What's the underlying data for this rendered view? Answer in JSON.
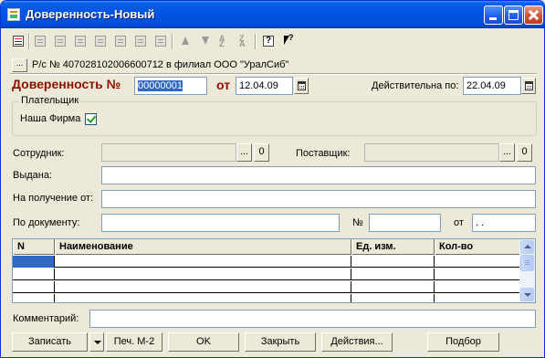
{
  "window": {
    "title": "Доверенность-Новый"
  },
  "toolbar": {
    "items": [
      {
        "name": "new-row-icon",
        "enabled": true
      },
      {
        "name": "copy-row-icon",
        "enabled": false
      },
      {
        "name": "edit-row-icon",
        "enabled": false
      },
      {
        "name": "delete-row-icon",
        "enabled": false
      },
      {
        "name": "mark-delete-icon",
        "enabled": false
      },
      {
        "name": "cut-icon",
        "enabled": false
      },
      {
        "name": "edit-cell-icon",
        "enabled": false
      },
      {
        "name": "end-edit-icon",
        "enabled": false
      },
      {
        "name": "move-up-icon",
        "enabled": false
      },
      {
        "name": "move-down-icon",
        "enabled": false
      },
      {
        "name": "sort-asc-icon",
        "enabled": false
      },
      {
        "name": "sort-desc-icon",
        "enabled": false
      },
      {
        "name": "help-icon",
        "enabled": true
      },
      {
        "name": "whats-this-icon",
        "enabled": true
      }
    ]
  },
  "account": {
    "button_label": "...",
    "text": "Р/с № 407028102006600712 в филиал ООО \"УралСиб\""
  },
  "header": {
    "doc_title": "Доверенность №",
    "number": "00000001",
    "from_label": "от",
    "date": "12.04.09",
    "valid_label": "Действительна по:",
    "valid_date": "22.04.09"
  },
  "payer": {
    "group_title": "Плательщик",
    "our_firm_label": "Наша Фирма",
    "our_firm_checked": true
  },
  "fields": {
    "employee_label": "Сотрудник:",
    "employee_value": "",
    "supplier_label": "Поставщик:",
    "supplier_value": "",
    "issued_label": "Выдана:",
    "issued_value": "",
    "receive_from_label": "На получение от:",
    "receive_from_value": "",
    "by_document_label": "По документу:",
    "by_document_value": "",
    "doc_number_label": "№",
    "doc_number_value": "",
    "doc_date_label": "от",
    "doc_date_value": " .  .",
    "select_button": "...",
    "clear_button": "0"
  },
  "table": {
    "columns": [
      "N",
      "Наименование",
      "Ед. изм.",
      "Кол-во"
    ],
    "rows": [
      [
        "",
        "",
        "",
        ""
      ],
      [
        "",
        "",
        "",
        ""
      ],
      [
        "",
        "",
        "",
        ""
      ],
      [
        "",
        "",
        "",
        ""
      ]
    ]
  },
  "comment": {
    "label": "Комментарий:",
    "value": ""
  },
  "buttons": {
    "save": "Записать",
    "print": "Печ. М-2",
    "ok": "OK",
    "close": "Закрыть",
    "actions": "Действия...",
    "select": "Подбор"
  },
  "colors": {
    "titlebar": "#0054e3",
    "doc_title": "#8c1000",
    "selection": "#316ac5",
    "face": "#ece9d8"
  }
}
